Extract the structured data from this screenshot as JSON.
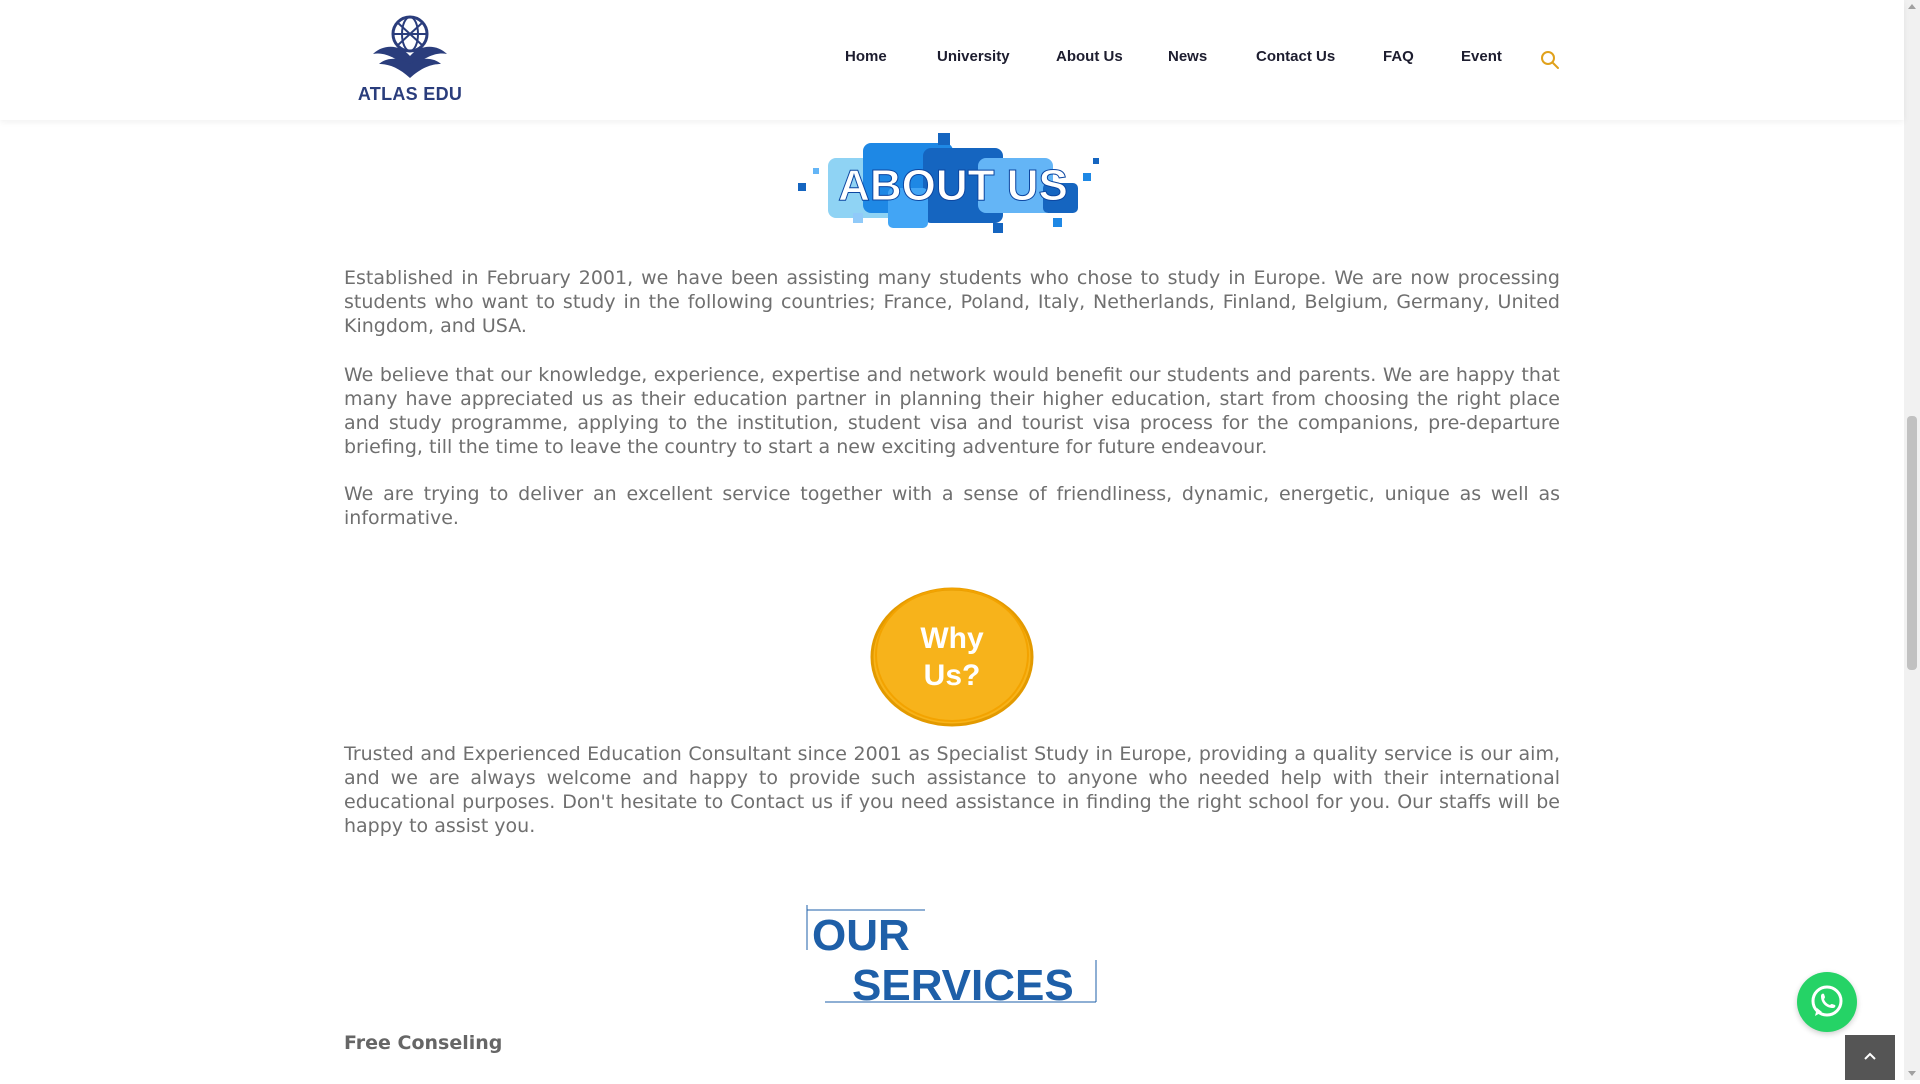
{
  "header": {
    "logo_text": "ATLAS EDU",
    "nav": [
      {
        "label": "Home"
      },
      {
        "label": "University"
      },
      {
        "label": "About Us"
      },
      {
        "label": "News"
      },
      {
        "label": "Contact Us"
      },
      {
        "label": "FAQ"
      },
      {
        "label": "Event"
      }
    ],
    "search_icon": "search-icon"
  },
  "about": {
    "graphic_text": "ABOUT US",
    "paragraphs": [
      "Established in February 2001, we have been assisting many students who chose to study in Europe. We are now processing students who want to study in the following countries; France, Poland, Italy, Netherlands, Finland, Belgium, Germany, United Kingdom, and USA.",
      "We believe that our knowledge, experience, expertise and network would benefit our students and parents. We are happy that many have appreciated us as their education partner in planning their higher education, start from choosing the right place and study programme, applying to the institution, student visa and tourist visa process for the companions, pre-departure briefing, till the time to leave the country to start a new exciting adventure for future endeavour.",
      "We are trying to deliver an excellent service together with a sense of friendliness, dynamic, energetic, unique as well as informative."
    ]
  },
  "why": {
    "graphic_line1": "Why",
    "graphic_line2": "Us?",
    "paragraph": "Trusted and Experienced Education Consultant since 2001 as Specialist Study in Europe, providing a quality service is our aim, and we are always welcome and happy to provide such assistance to anyone who needed help with their international educational purposes. Don't hesitate to Contact us if you need assistance in finding the right school for you. Our staffs will be happy to assist you."
  },
  "services": {
    "graphic_line1": "OUR",
    "graphic_line2": "SERVICES",
    "first_heading": "Free Conseling"
  },
  "floating": {
    "whatsapp_icon": "whatsapp-icon",
    "back_to_top_icon": "chevron-up-icon"
  },
  "colors": {
    "brand_navy": "#2a3d7c",
    "search_accent": "#e0a11b",
    "about_blue": "#1565c0",
    "why_yellow": "#f7b31b",
    "whatsapp_green": "#25d366"
  }
}
